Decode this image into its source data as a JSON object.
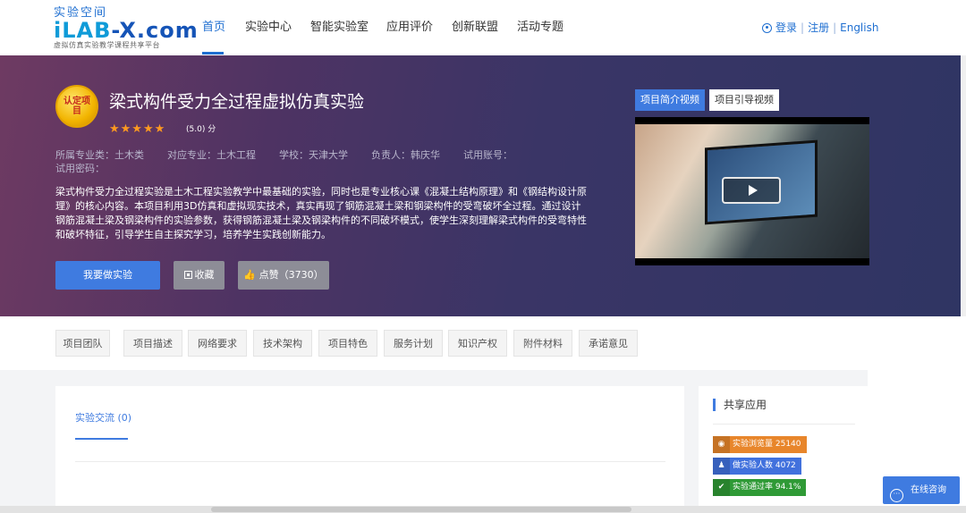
{
  "header": {
    "logo_top": "实验空间",
    "logo_main_prefix": "iLAB",
    "logo_main_suffix": "-X.com",
    "logo_sub": "虚拟仿真实验教学课程共享平台",
    "nav": [
      "首页",
      "实验中心",
      "智能实验室",
      "应用评价",
      "创新联盟",
      "活动专题"
    ],
    "auth": {
      "login": "登录",
      "register": "注册",
      "lang": "English"
    }
  },
  "hero": {
    "badge": "认定项目",
    "title": "梁式构件受力全过程虚拟仿真实验",
    "rating": "(5.0) 分",
    "stars": "★★★★★",
    "meta": {
      "category": "所属专业类：土木类",
      "major": "对应专业：土木工程",
      "school": "学校：天津大学",
      "leader": "负责人：韩庆华",
      "account": "试用账号：",
      "password": "试用密码："
    },
    "description": "梁式构件受力全过程实验是土木工程实验教学中最基础的实验，同时也是专业核心课《混凝土结构原理》和《钢结构设计原理》的核心内容。本项目利用3D仿真和虚拟现实技术，真实再现了钢筋混凝土梁和钢梁构件的受弯破坏全过程。通过设计钢筋混凝土梁及钢梁构件的实验参数，获得钢筋混凝土梁及钢梁构件的不同破坏模式，使学生深刻理解梁式构件的受弯特性和破坏特征，引导学生自主探究学习，培养学生实践创新能力。",
    "buttons": {
      "start": "我要做实验",
      "favorite": "收藏",
      "like": "点赞（3730）"
    },
    "video_tabs": [
      "项目简介视频",
      "项目引导视频"
    ]
  },
  "tabs": [
    "项目团队",
    "项目描述",
    "网络要求",
    "技术架构",
    "项目特色",
    "服务计划",
    "知识产权",
    "附件材料",
    "承诺意见"
  ],
  "exchange": {
    "tab": "实验交流 (0)"
  },
  "side": {
    "title": "共享应用",
    "stats": [
      {
        "label": "实验浏览量 25140",
        "icon": "eye-icon"
      },
      {
        "label": "做实验人数 4072",
        "icon": "person-icon"
      },
      {
        "label": "实验通过率 94.1%",
        "icon": "shield-check-icon"
      }
    ]
  },
  "consult": {
    "label": "在线咨询"
  }
}
